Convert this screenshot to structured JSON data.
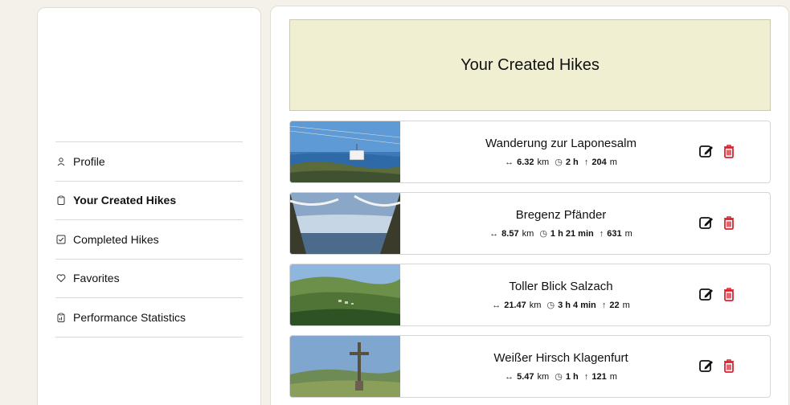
{
  "sidebar": {
    "items": [
      {
        "label": "Profile",
        "icon": "user-icon"
      },
      {
        "label": "Your Created Hikes",
        "icon": "clipboard-icon"
      },
      {
        "label": "Completed Hikes",
        "icon": "checkbox-icon"
      },
      {
        "label": "Favorites",
        "icon": "heart-icon"
      },
      {
        "label": "Performance Statistics",
        "icon": "stats-icon"
      }
    ]
  },
  "main": {
    "title": "Your Created Hikes",
    "hikes": [
      {
        "title": "Wanderung zur Laponesalm",
        "distance": "6.32",
        "distance_unit": "km",
        "duration": "2 h",
        "elevation": "204",
        "elevation_unit": "m"
      },
      {
        "title": "Bregenz Pfänder",
        "distance": "8.57",
        "distance_unit": "km",
        "duration": "1 h 21 min",
        "elevation": "631",
        "elevation_unit": "m"
      },
      {
        "title": "Toller Blick Salzach",
        "distance": "21.47",
        "distance_unit": "km",
        "duration": "3 h 4 min",
        "elevation": "22",
        "elevation_unit": "m"
      },
      {
        "title": "Weißer Hirsch Klagenfurt",
        "distance": "5.47",
        "distance_unit": "km",
        "duration": "1 h",
        "elevation": "121",
        "elevation_unit": "m"
      }
    ]
  },
  "colors": {
    "delete": "#d9232e",
    "header_bg": "#f0efd2"
  }
}
